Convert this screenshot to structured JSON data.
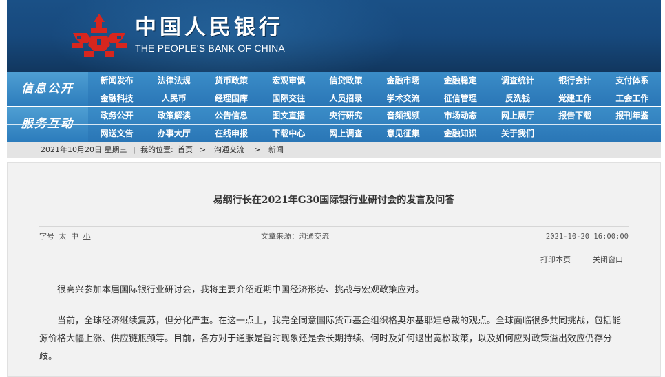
{
  "header": {
    "logo_cn": "中国人民银行",
    "logo_en": "THE PEOPLE'S BANK OF CHINA"
  },
  "nav": [
    {
      "title": "信息公开",
      "items": [
        "新闻发布",
        "法律法规",
        "货币政策",
        "宏观审慎",
        "信贷政策",
        "金融市场",
        "金融稳定",
        "调查统计",
        "银行会计",
        "支付体系",
        "金融科技",
        "人民币",
        "经理国库",
        "国际交往",
        "人员招录",
        "学术交流",
        "征信管理",
        "反洗钱",
        "党建工作",
        "工会工作"
      ]
    },
    {
      "title": "服务互动",
      "items": [
        "政务公开",
        "政策解读",
        "公告信息",
        "图文直播",
        "央行研究",
        "音频视频",
        "市场动态",
        "网上展厅",
        "报告下载",
        "报刊年鉴",
        "网送文告",
        "办事大厅",
        "在线申报",
        "下载中心",
        "网上调查",
        "意见征集",
        "金融知识",
        "关于我们",
        "",
        ""
      ]
    }
  ],
  "breadcrumb": {
    "date": "2021年10月20日 星期三",
    "sep": "|",
    "location_label": "我的位置:",
    "home": "首页",
    "arrow1": ">",
    "section": "沟通交流",
    "arrow2": ">",
    "current": "新闻"
  },
  "article": {
    "title": "易纲行长在2021年G30国际银行业研讨会的发言及问答",
    "font_size_label": "字号",
    "font_sizes": [
      "太",
      "中",
      "小"
    ],
    "source": "文章来源：沟通交流",
    "datetime": "2021-10-20 16:00:00",
    "print": "打印本页",
    "close": "关闭窗口",
    "paragraphs": [
      "很高兴参加本届国际银行业研讨会，我将主要介绍近期中国经济形势、挑战与宏观政策应对。",
      "当前，全球经济继续复苏，但分化严重。在这一点上，我完全同意国际货币基金组织格奥尔基耶娃总裁的观点。全球面临很多共同挑战，包括能源价格大幅上涨、供应链瓶颈等。目前，各方对于通胀是暂时现象还是会长期持续、何时及如何退出宽松政策，以及如何应对政策溢出效应仍存分歧。"
    ]
  },
  "colors": {
    "header_bg": "#17497d",
    "nav_bg": "#2a76b6",
    "emblem_red": "#d7261e",
    "crumb_bg": "#e4e4e4",
    "article_bg": "#f2f2f2"
  }
}
